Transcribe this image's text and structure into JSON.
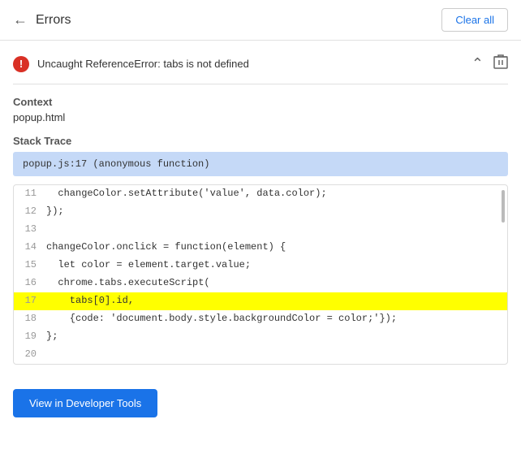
{
  "header": {
    "back_label": "←",
    "title": "Errors",
    "clear_all_label": "Clear all"
  },
  "error": {
    "message": "Uncaught ReferenceError: tabs is not defined",
    "context_label": "Context",
    "context_value": "popup.html",
    "stack_trace_label": "Stack Trace",
    "stack_trace_value": "popup.js:17 (anonymous function)"
  },
  "code": {
    "lines": [
      {
        "num": "11",
        "code": "  changeColor.setAttribute('value', data.color);",
        "highlight": false
      },
      {
        "num": "12",
        "code": "});",
        "highlight": false
      },
      {
        "num": "13",
        "code": "",
        "highlight": false
      },
      {
        "num": "14",
        "code": "changeColor.onclick = function(element) {",
        "highlight": false
      },
      {
        "num": "15",
        "code": "  let color = element.target.value;",
        "highlight": false
      },
      {
        "num": "16",
        "code": "  chrome.tabs.executeScript(",
        "highlight": false
      },
      {
        "num": "17",
        "code": "    tabs[0].id,",
        "highlight": true
      },
      {
        "num": "18",
        "code": "    {code: 'document.body.style.backgroundColor = color;'});",
        "highlight": false
      },
      {
        "num": "19",
        "code": "};",
        "highlight": false
      },
      {
        "num": "20",
        "code": "",
        "highlight": false
      }
    ]
  },
  "footer": {
    "view_devtools_label": "View in Developer Tools"
  }
}
